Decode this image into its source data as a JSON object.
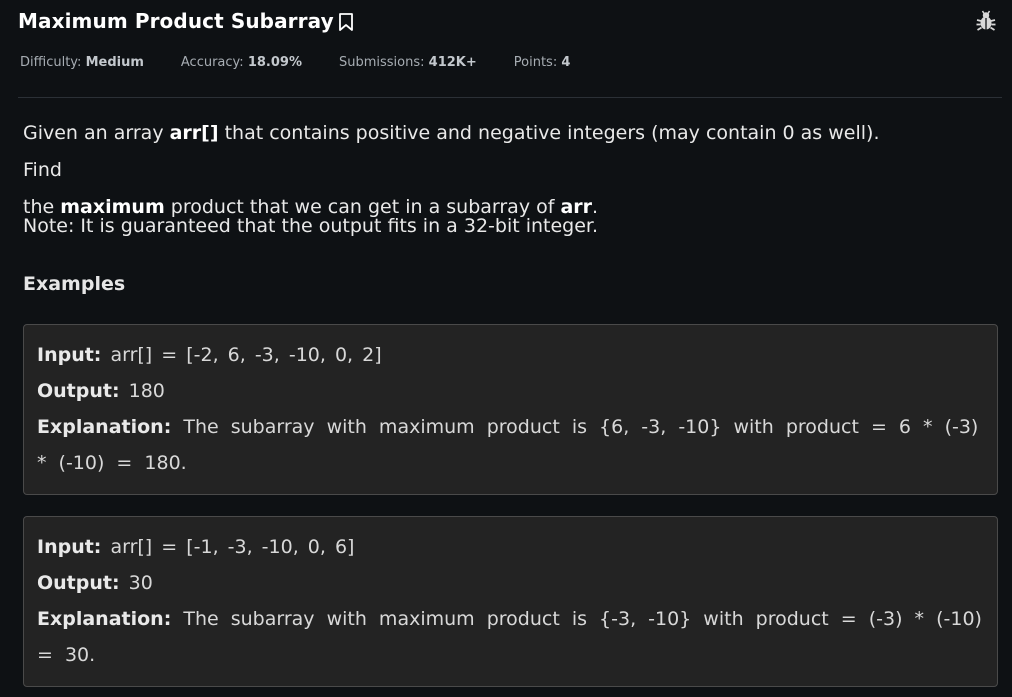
{
  "problem": {
    "title": "Maximum Product Subarray",
    "bookmark_icon": "bookmark-icon",
    "report_icon": "bug-icon"
  },
  "meta": {
    "difficulty_label": "Difficulty:",
    "difficulty_value": "Medium",
    "accuracy_label": "Accuracy:",
    "accuracy_value": "18.09%",
    "submissions_label": "Submissions:",
    "submissions_value": "412K+",
    "points_label": "Points:",
    "points_value": "4"
  },
  "description": {
    "p1_a": "Given an array ",
    "p1_b": "arr[]",
    "p1_c": " that contains positive and negative integers (may contain 0 as well). Find",
    "p1_d": "the ",
    "p1_e": "maximum",
    "p1_f": " product that we can get in a subarray of ",
    "p1_g": "arr",
    "p1_h": ".",
    "note": "Note: It is guaranteed that the output fits in a 32-bit integer."
  },
  "examples_heading": "Examples",
  "examples": [
    {
      "input_label": "Input:",
      "input": "arr[] = [-2, 6, -3, -10, 0, 2]",
      "output_label": "Output:",
      "output": "180",
      "explanation_label": "Explanation:",
      "explanation": "The subarray with maximum product is {6, -3, -10} with product = 6 * (-3) * (-10) = 180."
    },
    {
      "input_label": "Input:",
      "input": "arr[] = [-1, -3, -10, 0, 6]",
      "output_label": "Output:",
      "output": "30",
      "explanation_label": "Explanation:",
      "explanation": "The subarray with maximum product is {-3, -10} with product = (-3) * (-10) = 30."
    }
  ]
}
